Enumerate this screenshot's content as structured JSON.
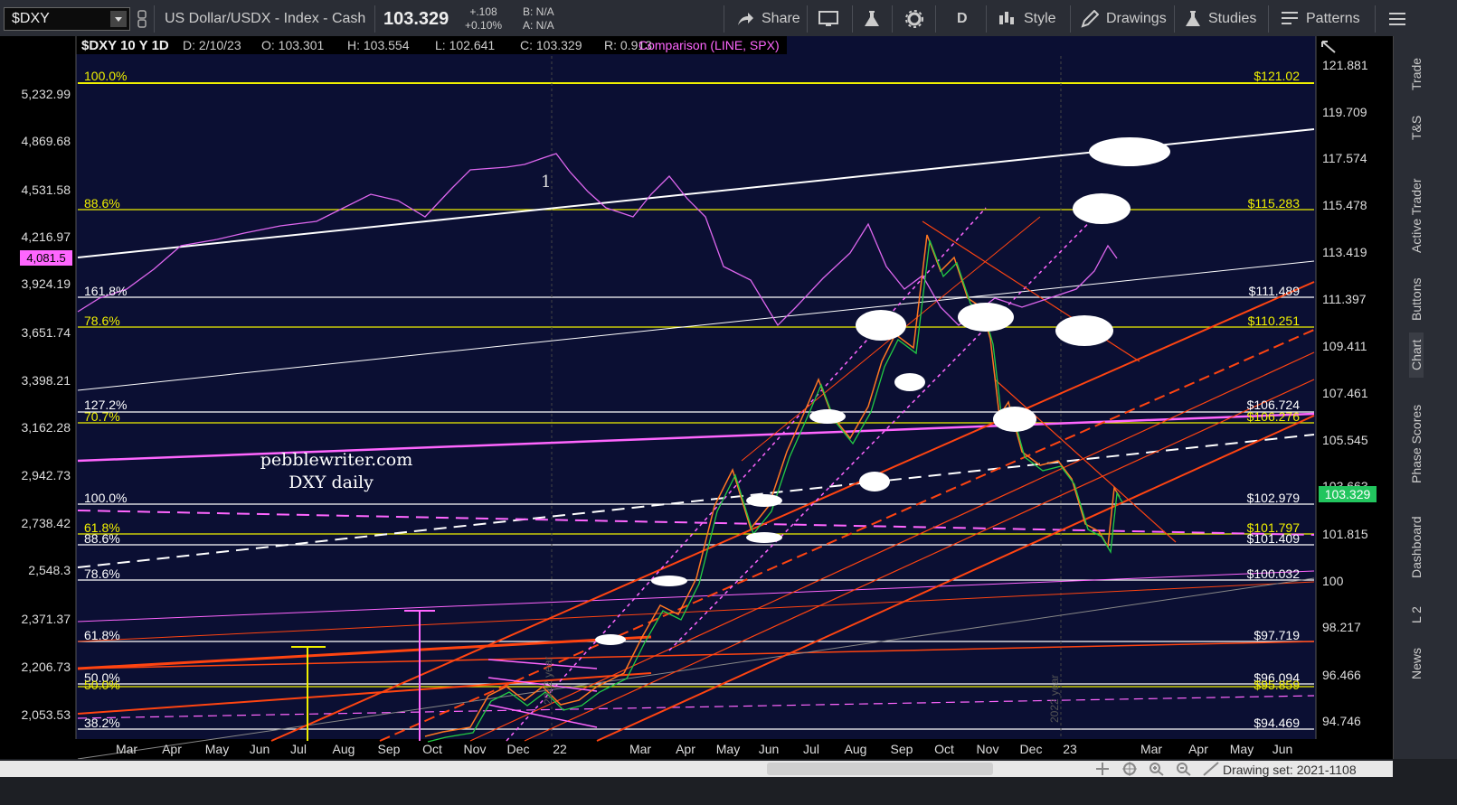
{
  "toolbar": {
    "symbol": "$DXY",
    "description": "US Dollar/USDX - Index - Cash",
    "last": "103.329",
    "change": "+.108",
    "change_pct": "+0.10%",
    "bid": "B: N/A",
    "ask": "A: N/A",
    "share": "Share",
    "period": "D",
    "style": "Style",
    "drawings": "Drawings",
    "studies": "Studies",
    "patterns": "Patterns"
  },
  "header": {
    "title": "$DXY 10 Y 1D",
    "date": "D: 2/10/23",
    "open": "O: 103.301",
    "high": "H: 103.554",
    "low": "L: 102.641",
    "close": "C: 103.329",
    "range": "R: 0.913",
    "comparison": "Comparison (LINE, SPX)"
  },
  "watermark": {
    "line1": "pebblewriter.com",
    "line2": "DXY daily"
  },
  "label_1": "1",
  "year_labels": [
    "2022 year",
    "2022 year"
  ],
  "left_axis": [
    "5,232.99",
    "4,869.68",
    "4,531.58",
    "4,216.97",
    "3,924.19",
    "3,651.74",
    "3,398.21",
    "3,162.28",
    "2,942.73",
    "2,738.42",
    "2,548.3",
    "2,371.37",
    "2,206.73",
    "2,053.53"
  ],
  "left_badge": "4,081.5",
  "right_axis": [
    "121.881",
    "119.709",
    "117.574",
    "115.478",
    "113.419",
    "111.397",
    "109.411",
    "107.461",
    "105.545",
    "103.663",
    "101.815",
    "100",
    "98.217",
    "96.466",
    "94.746"
  ],
  "right_badge": "103.329",
  "x_axis": [
    "Mar",
    "Apr",
    "May",
    "Jun",
    "Jul",
    "Aug",
    "Sep",
    "Oct",
    "Nov",
    "Dec",
    "22",
    "Mar",
    "Apr",
    "May",
    "Jun",
    "Jul",
    "Aug",
    "Sep",
    "Oct",
    "Nov",
    "Dec",
    "23",
    "Mar",
    "Apr",
    "May",
    "Jun"
  ],
  "fib_left": [
    {
      "label": "100.0%",
      "color": "#f0f000"
    },
    {
      "label": "88.6%",
      "color": "#f0f000"
    },
    {
      "label": "161.8%",
      "color": "#ffffff"
    },
    {
      "label": "78.6%",
      "color": "#f0f000"
    },
    {
      "label": "127.2%",
      "color": "#ffffff"
    },
    {
      "label": "70.7%",
      "color": "#f0f000"
    },
    {
      "label": "100.0%",
      "color": "#ffffff"
    },
    {
      "label": "61.8%",
      "color": "#f0f000"
    },
    {
      "label": "88.6%",
      "color": "#ffffff"
    },
    {
      "label": "78.6%",
      "color": "#ffffff"
    },
    {
      "label": "61.8%",
      "color": "#ffffff"
    },
    {
      "label": "50.0%",
      "color": "#ffffff"
    },
    {
      "label": "50.0%",
      "color": "#f0f000"
    },
    {
      "label": "38.2%",
      "color": "#ffffff"
    }
  ],
  "fib_right": [
    {
      "label": "$121.02",
      "color": "#f0f000"
    },
    {
      "label": "$115.283",
      "color": "#f0f000"
    },
    {
      "label": "$111.489",
      "color": "#ffffff"
    },
    {
      "label": "$110.251",
      "color": "#f0f000"
    },
    {
      "label": "$106.724",
      "color": "#ffffff"
    },
    {
      "label": "$106.276",
      "color": "#f0f000"
    },
    {
      "label": "$102.979",
      "color": "#ffffff"
    },
    {
      "label": "$101.797",
      "color": "#f0f000"
    },
    {
      "label": "$101.409",
      "color": "#ffffff"
    },
    {
      "label": "$100.032",
      "color": "#ffffff"
    },
    {
      "label": "$97.719",
      "color": "#ffffff"
    },
    {
      "label": "$96.094",
      "color": "#ffffff"
    },
    {
      "label": "$95.859",
      "color": "#f0f000"
    },
    {
      "label": "$94.469",
      "color": "#ffffff"
    }
  ],
  "right_tabs": [
    "Trade",
    "T&S",
    "Active Trader",
    "Buttons",
    "Chart",
    "Phase Scores",
    "Dashboard",
    "L 2",
    "News"
  ],
  "drawing_set": "Drawing set: 2021-1108"
}
